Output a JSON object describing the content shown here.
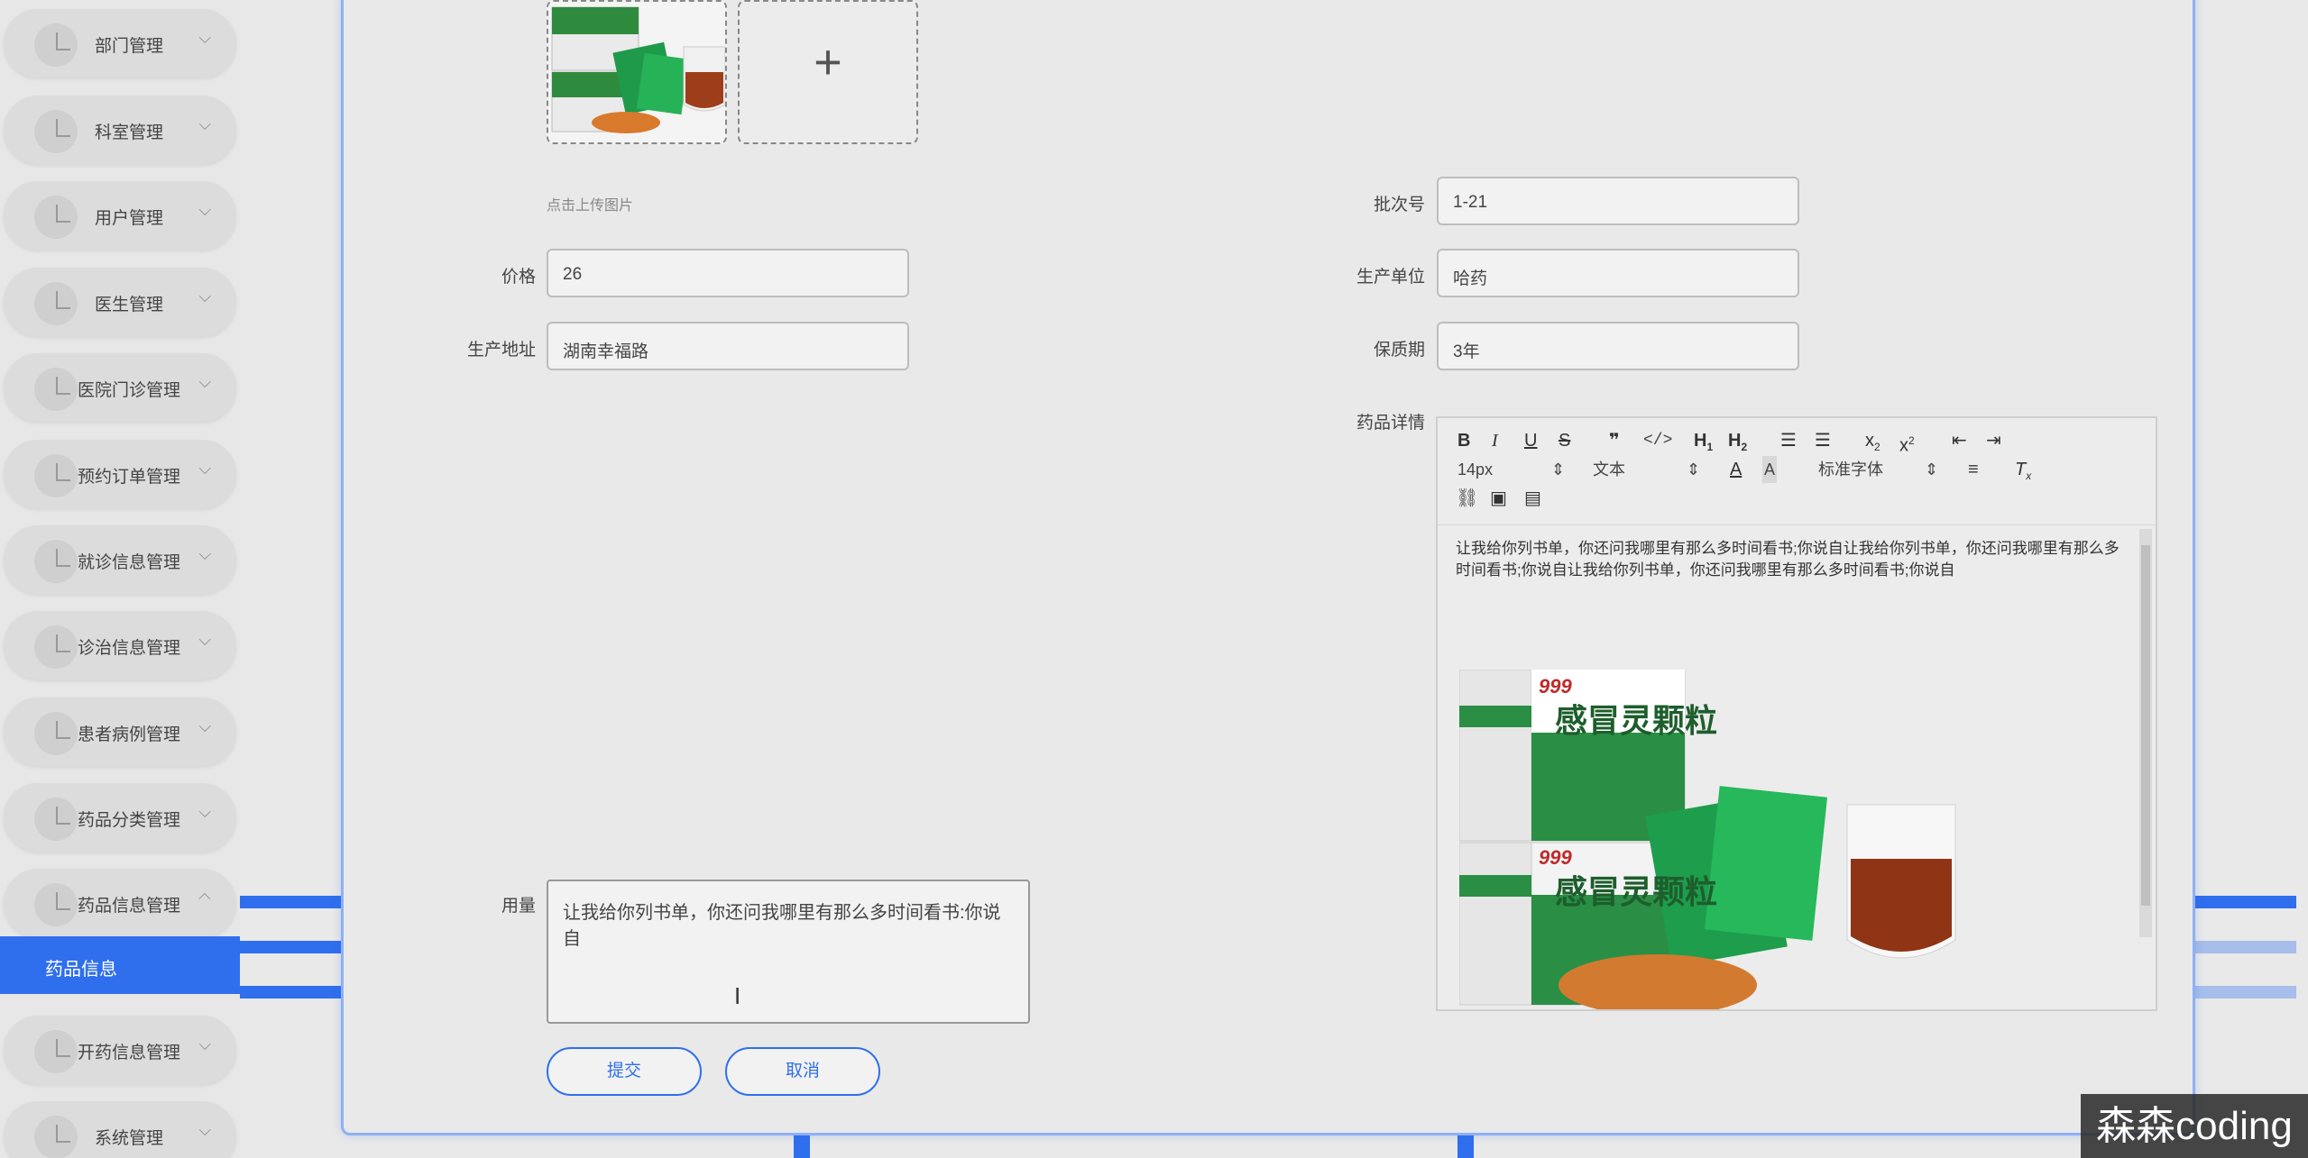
{
  "sidebar": {
    "items": [
      {
        "label": "部门管理"
      },
      {
        "label": "科室管理"
      },
      {
        "label": "用户管理"
      },
      {
        "label": "医生管理"
      },
      {
        "label": "医院门诊管理"
      },
      {
        "label": "预约订单管理"
      },
      {
        "label": "就诊信息管理"
      },
      {
        "label": "诊治信息管理"
      },
      {
        "label": "患者病例管理"
      },
      {
        "label": "药品分类管理"
      },
      {
        "label": "药品信息管理"
      },
      {
        "label": "开药信息管理"
      },
      {
        "label": "系统管理"
      }
    ],
    "active_sub": "药品信息"
  },
  "upload": {
    "hint": "点击上传图片"
  },
  "form": {
    "price_label": "价格",
    "price_value": "26",
    "address_label": "生产地址",
    "address_value": "湖南幸福路",
    "batch_label": "批次号",
    "batch_value": "1-21",
    "maker_label": "生产单位",
    "maker_value": "哈药",
    "shelf_label": "保质期",
    "shelf_value": "3年",
    "detail_label": "药品详情",
    "usage_label": "用量",
    "usage_value": "让我给你列书单，你还问我哪里有那么多时间看书:你说自"
  },
  "editor": {
    "font_size": "14px",
    "paragraph": "文本",
    "font_family": "标准字体",
    "content": "让我给你列书单，你还问我哪里有那么多时间看书;你说自让我给你列书单，你还问我哪里有那么多时间看书;你说自让我给你列书单，你还问我哪里有那么多时间看书;你说自",
    "box_brand": "999",
    "box_title": "感冒灵颗粒"
  },
  "buttons": {
    "submit": "提交",
    "cancel": "取消"
  },
  "watermark": "森森coding",
  "colors": {
    "accent": "#2f6fed",
    "card_border": "#8fb0f5"
  }
}
